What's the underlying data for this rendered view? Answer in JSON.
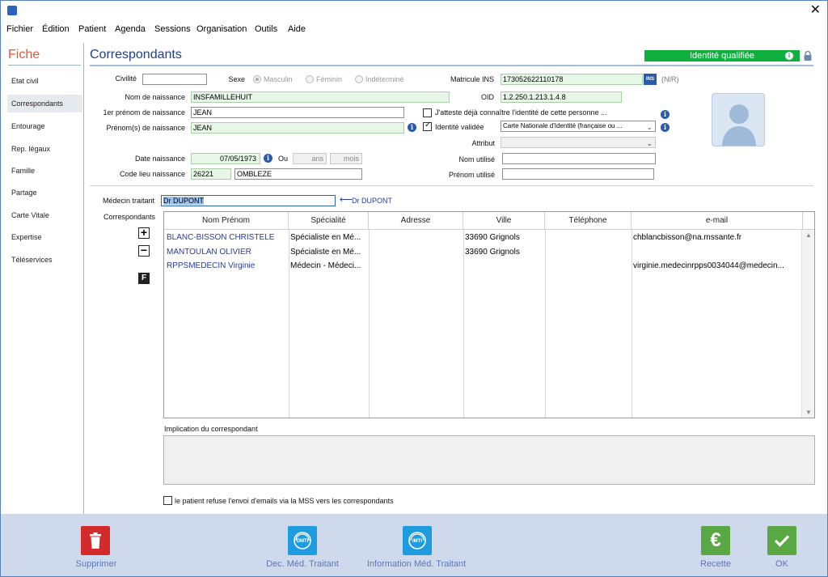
{
  "menu": [
    "Fichier",
    "Édition",
    "Patient",
    "Agenda",
    "Sessions",
    "Organisation",
    "Outils",
    "Aide"
  ],
  "sidebar": {
    "title": "Fiche",
    "items": [
      {
        "label": "Etat civil"
      },
      {
        "label": "Correspondants",
        "active": true
      },
      {
        "label": "Entourage"
      },
      {
        "label": "Rep. légaux"
      },
      {
        "label": "Famille"
      },
      {
        "label": "Partage"
      },
      {
        "label": "Carte Vitale"
      },
      {
        "label": "Expertise"
      },
      {
        "label": "Téléservices"
      }
    ]
  },
  "main": {
    "title": "Correspondants",
    "identity_badge": "Identité qualifiée"
  },
  "form": {
    "civilite_label": "Civilité",
    "civilite_value": "",
    "sexe_label": "Sexe",
    "sexe_options": [
      "Masculin",
      "Féminin",
      "Indéterminé"
    ],
    "sexe_selected": "Masculin",
    "nom_label": "Nom de naissance",
    "nom_value": "INSFAMILLEHUIT",
    "prenom1_label": "1er prénom de naissance",
    "prenom1_value": "JEAN",
    "prenoms_label": "Prénom(s) de naissance",
    "prenoms_value": "JEAN",
    "date_label": "Date naissance",
    "date_value": "07/05/1973",
    "ou_label": "Ou",
    "ans_placeholder": "ans",
    "mois_placeholder": "mois",
    "code_lieu_label": "Code lieu naissance",
    "code_lieu_value": "26221",
    "lieu_value": "OMBLEZE",
    "matricule_label": "Matricule INS",
    "matricule_value": "173052622110178",
    "ins_tag": "INS",
    "nir_label": "(NIR)",
    "oid_label": "OID",
    "oid_value": "1.2.250.1.213.1.4.8",
    "atteste_label": "J'atteste déjà connaître l'identité de cette personne ...",
    "atteste_checked": false,
    "identite_validee_label": "Identité validée",
    "identite_validee_checked": true,
    "piece_value": "Carte Nationale d'Identité (française ou ...",
    "attribut_label": "Attribut",
    "attribut_value": "",
    "nom_utilise_label": "Nom utilisé",
    "nom_utilise_value": "",
    "prenom_utilise_label": "Prénom utilisé",
    "prenom_utilise_value": ""
  },
  "medecin": {
    "label": "Médecin traitant",
    "value": "Dr DUPONT",
    "arrow_text": "Dr DUPONT"
  },
  "correspondants": {
    "label": "Correspondants",
    "add_symbol": "+",
    "remove_symbol": "−",
    "f_label": "F",
    "columns": [
      "Nom Prénom",
      "Spécialité",
      "Adresse",
      "Ville",
      "Téléphone",
      "e-mail"
    ],
    "rows": [
      {
        "nom": "BLANC-BISSON CHRISTELE",
        "specialite": "Spécialiste en Mé...",
        "adresse": "",
        "ville": "33690 Grignols",
        "telephone": "",
        "email": "chblancbisson@na.mssante.fr"
      },
      {
        "nom": "MANTOULAN OLIVIER",
        "specialite": "Spécialiste en Mé...",
        "adresse": "",
        "ville": "33690 Grignols",
        "telephone": "",
        "email": ""
      },
      {
        "nom": "RPPSMEDECIN Virginie",
        "specialite": "Médecin - Médeci...",
        "adresse": "",
        "ville": "",
        "telephone": "",
        "email": "virginie.medecinrpps0034044@medecin..."
      }
    ]
  },
  "implication": {
    "label": "Implication du correspondant",
    "value": ""
  },
  "refus": {
    "label": "le patient refuse l'envoi d'emails via la MSS vers les correspondants",
    "checked": false
  },
  "footer": {
    "supprimer": "Supprimer",
    "dec_med": "Dec. Méd. Traitant",
    "info_med": "Information Méd. Traitant",
    "recette": "Recette",
    "ok": "OK",
    "dmti_tag": "DMTI",
    "imti_tag": "IMTI",
    "colors": {
      "supprimer": "#d32b2b",
      "dmti": "#1f9be0",
      "recette": "#5aa843",
      "ok": "#5aa843"
    }
  }
}
